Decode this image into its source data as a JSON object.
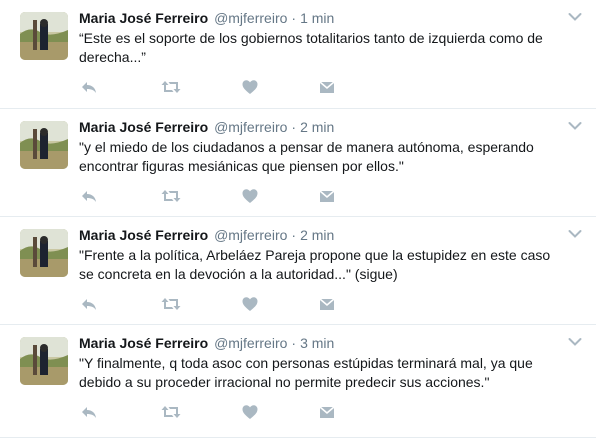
{
  "tweets": [
    {
      "fullname": "Maria José Ferreiro",
      "username": "@mjferreiro",
      "separator": "·",
      "time": "1 min",
      "text": "“Este es el soporte de los gobiernos totalitarios tanto de izquierda como de derecha...”"
    },
    {
      "fullname": "Maria José Ferreiro",
      "username": "@mjferreiro",
      "separator": "·",
      "time": "2 min",
      "text": "\"y el miedo de los ciudadanos a pensar de manera autónoma, esperando encontrar figuras  mesiánicas que piensen por ellos.\""
    },
    {
      "fullname": "Maria José Ferreiro",
      "username": "@mjferreiro",
      "separator": "·",
      "time": "2 min",
      "text": "\"Frente a la política, Arbeláez Pareja propone que la estupidez en  este caso se concreta en la devoción a la autoridad...\" (sigue)"
    },
    {
      "fullname": "Maria José Ferreiro",
      "username": "@mjferreiro",
      "separator": "·",
      "time": "3 min",
      "text": "\"Y finalmente, q toda asoc con personas estúpidas terminará mal, ya que debido a su proceder irracional no permite predecir sus  acciones.\""
    }
  ],
  "icons": {
    "reply": "reply-icon",
    "retweet": "retweet-icon",
    "like": "heart-icon",
    "dm": "envelope-icon",
    "more": "chevron-down-icon"
  },
  "colors": {
    "text": "#14171a",
    "secondary": "#657786",
    "icon": "#aab8c2",
    "divider": "#e6ecf0"
  }
}
